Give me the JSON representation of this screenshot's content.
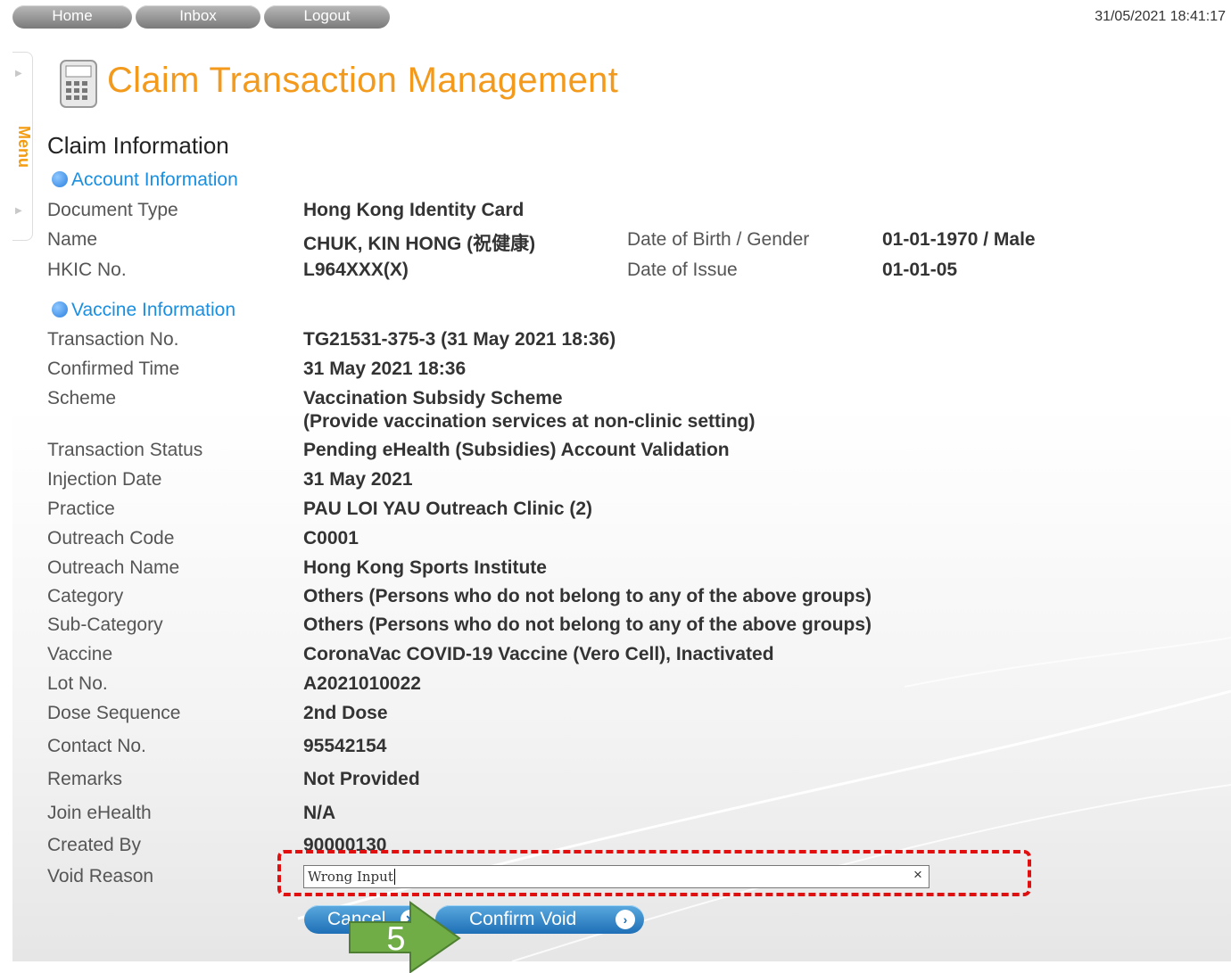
{
  "nav": {
    "home_label": "Home",
    "inbox_label": "Inbox",
    "logout_label": "Logout",
    "datetime": "31/05/2021 18:41:17"
  },
  "menu": {
    "label": "Menu"
  },
  "page": {
    "title": "Claim Transaction Management",
    "section_title": "Claim Information"
  },
  "account": {
    "heading": "Account Information",
    "document_type_label": "Document Type",
    "document_type_value": "Hong Kong Identity Card",
    "name_label": "Name",
    "name_value": "CHUK, KIN HONG (祝健康)",
    "dob_label": "Date of Birth / Gender",
    "dob_value": "01-01-1970 / Male",
    "hkic_label": "HKIC No.",
    "hkic_value": "L964XXX(X)",
    "issue_label": "Date of Issue",
    "issue_value": "01-01-05"
  },
  "vaccine": {
    "heading": "Vaccine Information",
    "rows": [
      {
        "label": "Transaction No.",
        "value": "TG21531-375-3 (31 May 2021 18:36)"
      },
      {
        "label": "Confirmed Time",
        "value": "31 May 2021 18:36"
      },
      {
        "label": "Scheme",
        "value": "Vaccination Subsidy Scheme",
        "value2": "(Provide vaccination services at non-clinic setting)"
      },
      {
        "label": "Transaction Status",
        "value": "Pending eHealth (Subsidies) Account Validation"
      },
      {
        "label": "Injection Date",
        "value": "31 May 2021"
      },
      {
        "label": "Practice",
        "value": "PAU LOI YAU Outreach Clinic (2)"
      },
      {
        "label": "Outreach Code",
        "value": "C0001"
      },
      {
        "label": "Outreach Name",
        "value": "Hong Kong Sports Institute"
      },
      {
        "label": "Category",
        "value": "Others (Persons who do not belong to any of the above groups)"
      },
      {
        "label": "Sub-Category",
        "value": "Others (Persons who do not belong to any of the above groups)"
      },
      {
        "label": "Vaccine",
        "value": "CoronaVac COVID-19 Vaccine (Vero Cell), Inactivated"
      },
      {
        "label": "Lot No.",
        "value": "A2021010022"
      },
      {
        "label": "Dose Sequence",
        "value": "2nd Dose"
      },
      {
        "label": "Contact No.",
        "value": "95542154"
      },
      {
        "label": "Remarks",
        "value": "Not Provided"
      },
      {
        "label": "Join eHealth",
        "value": "N/A"
      },
      {
        "label": "Created By",
        "value": "90000130"
      }
    ]
  },
  "void": {
    "label": "Void Reason",
    "value": "Wrong Input",
    "clear": "×"
  },
  "buttons": {
    "cancel": "Cancel",
    "confirm": "Confirm Void"
  },
  "step": {
    "number": "5"
  }
}
